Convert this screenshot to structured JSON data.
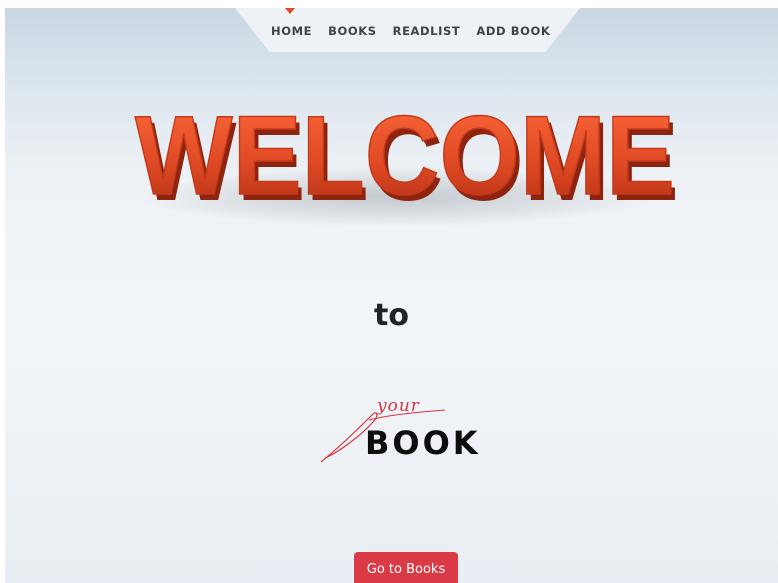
{
  "nav": {
    "items": [
      {
        "label": "HOME",
        "active": true
      },
      {
        "label": "BOOKS"
      },
      {
        "label": "READLIST"
      },
      {
        "label": "ADD BOOK"
      }
    ]
  },
  "hero": {
    "welcome": "WELCOME",
    "to": "to",
    "logo_script": "your",
    "logo_word": "BOOK"
  },
  "cta": {
    "label": "Go to Books"
  },
  "colors": {
    "accent": "#d93a45",
    "welcome_letters": "#e04a24",
    "nav_text": "#3d434b"
  }
}
